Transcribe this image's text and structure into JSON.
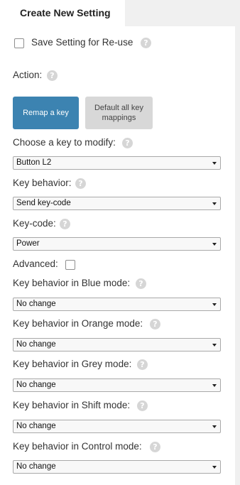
{
  "tab": {
    "title": "Create New Setting"
  },
  "save_setting": {
    "label": "Save Setting for Re-use",
    "checked": false
  },
  "action": {
    "label": "Action:",
    "buttons": {
      "remap": "Remap a key",
      "default_all": "Default all key mappings"
    }
  },
  "key_select": {
    "label": "Choose a key to modify:",
    "value": "Button L2"
  },
  "key_behavior": {
    "label": "Key behavior:",
    "value": "Send key-code"
  },
  "key_code": {
    "label": "Key-code:",
    "value": "Power"
  },
  "advanced": {
    "label": "Advanced:",
    "checked": false
  },
  "modes": {
    "blue": {
      "label": "Key behavior in Blue mode:",
      "value": "No change"
    },
    "orange": {
      "label": "Key behavior in Orange mode:",
      "value": "No change"
    },
    "grey": {
      "label": "Key behavior in Grey mode:",
      "value": "No change"
    },
    "shift": {
      "label": "Key behavior in Shift mode:",
      "value": "No change"
    },
    "control": {
      "label": "Key behavior in Control mode:",
      "value": "No change"
    }
  },
  "help_glyph": "?",
  "icons": {
    "help": "question-circle-icon",
    "dropdown": "chevron-down-icon"
  },
  "colors": {
    "primary_button": "#3c83b1",
    "secondary_button": "#d8d8d8",
    "help_icon": "#d6d6d6"
  }
}
